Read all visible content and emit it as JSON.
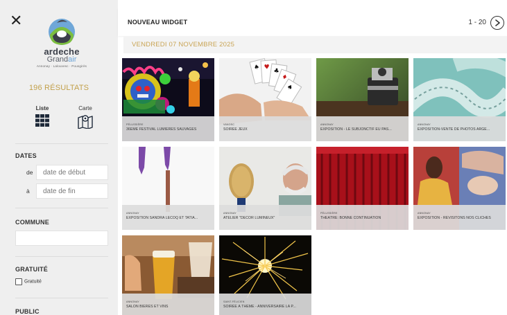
{
  "sidebar": {
    "close_label": "✕",
    "logo": {
      "line1": "ardeche",
      "line2_a": "Grand",
      "line2_b": "air",
      "line3": "Annonay · Lalouvesc · Pousgirès"
    },
    "results": "196 RÉSULTATS",
    "view_list": "Liste",
    "view_map": "Carte",
    "dates_title": "DATES",
    "date_from_label": "de",
    "date_from_placeholder": "date de début",
    "date_to_label": "à",
    "date_to_placeholder": "date de fin",
    "commune_title": "COMMUNE",
    "gratuite_title": "GRATUITÉ",
    "gratuite_checkbox": "Gratuité",
    "public_title": "PUBLIC"
  },
  "header": {
    "title": "NOUVEAU WIDGET",
    "pagination": "1 - 20"
  },
  "date_band": "VENDREDI 07 NOVEMBRE 2025",
  "cards": [
    {
      "category": "Pélussière",
      "title": "36ÈME FESTIVAL LUMIÈRES SAUVAGES",
      "icon": "lantern-festival-image"
    },
    {
      "category": "Vanosc",
      "title": "SOIRÉE JEUX",
      "icon": "playing-cards-image"
    },
    {
      "category": "Annonay",
      "title": "EXPOSITION - LE SUBJONCTIF EU PAS...",
      "icon": "vintage-camera-image"
    },
    {
      "category": "Annonay",
      "title": "EXPOSITION-VENTE DE PHOTOS ARGE...",
      "icon": "film-strip-image"
    },
    {
      "category": "Annonay",
      "title": "EXPOSITION SANDRA LECOQ ET TATIA...",
      "icon": "sculpture-image"
    },
    {
      "category": "Annonay",
      "title": "ATELIER \"DÉCOR LUMINEUX\"",
      "icon": "workshop-man-image"
    },
    {
      "category": "Pélussière",
      "title": "THÉÂTRE: BONNE CONTINUATION",
      "icon": "theatre-curtain-image"
    },
    {
      "category": "Annonay",
      "title": "EXPOSITION - REVISITONS NOS CLICHÉS",
      "icon": "paintings-image"
    },
    {
      "category": "Annonay",
      "title": "SALON BIÈRES ET VINS",
      "icon": "beer-glass-image"
    },
    {
      "category": "Saint-Félicien",
      "title": "SOIRÉE À THÈME - ANNIVERSAIRE LA P...",
      "icon": "sparkler-image"
    }
  ],
  "colors": {
    "accent_gold": "#c2a04a",
    "sidebar_bg": "#efefef",
    "caption_bg": "#dcdcdc"
  }
}
